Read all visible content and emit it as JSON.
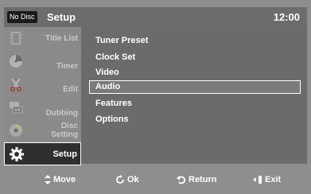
{
  "header": {
    "disc_status": "No Disc",
    "title": "Setup",
    "time": "12:00"
  },
  "sidebar": {
    "items": [
      {
        "label": "Title List",
        "icon": "film-icon"
      },
      {
        "label": "Timer",
        "icon": "clock-icon"
      },
      {
        "label": "Edit",
        "icon": "scissors-icon"
      },
      {
        "label": "Dubbing",
        "icon": "dubbing-icon"
      },
      {
        "label_line1": "Disc",
        "label_line2": "Setting",
        "icon": "disc-icon"
      },
      {
        "label": "Setup",
        "icon": "gear-icon"
      }
    ]
  },
  "menu": {
    "items": [
      "Tuner Preset",
      "Clock Set",
      "Video",
      "Audio",
      "Features",
      "Options"
    ],
    "selected_index": 3
  },
  "footer": {
    "move": "Move",
    "ok": "Ok",
    "return": "Return",
    "exit": "Exit"
  },
  "colors": {
    "background": "#8e8e8e",
    "panel": "#6b6b6b",
    "active_item": "#2f2f2f",
    "text": "#ffffff"
  }
}
